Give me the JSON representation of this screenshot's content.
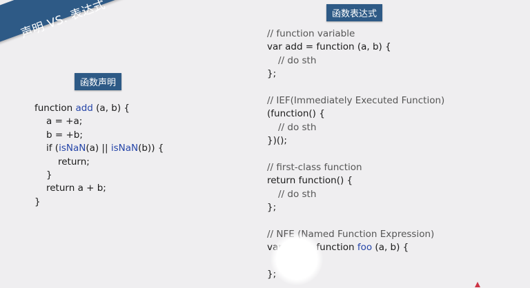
{
  "banner": {
    "title": "声明 VS. 表达式"
  },
  "declaration": {
    "label": "函数声明",
    "code": [
      {
        "segments": [
          {
            "t": "function "
          },
          {
            "t": "add",
            "c": "fn"
          },
          {
            "t": " (a, b) {"
          }
        ]
      },
      {
        "indent": 1,
        "segments": [
          {
            "t": "a = +a;"
          }
        ]
      },
      {
        "indent": 1,
        "segments": [
          {
            "t": "b = +b;"
          }
        ]
      },
      {
        "indent": 1,
        "segments": [
          {
            "t": "if ("
          },
          {
            "t": "isNaN",
            "c": "fn"
          },
          {
            "t": "(a) || "
          },
          {
            "t": "isNaN",
            "c": "fn"
          },
          {
            "t": "(b)) {"
          }
        ]
      },
      {
        "indent": 2,
        "segments": [
          {
            "t": "return;"
          }
        ]
      },
      {
        "indent": 1,
        "segments": [
          {
            "t": "}"
          }
        ]
      },
      {
        "indent": 1,
        "segments": [
          {
            "t": "return a + b;"
          }
        ]
      },
      {
        "segments": [
          {
            "t": "}"
          }
        ]
      }
    ]
  },
  "expression": {
    "label": "函数表达式",
    "code": [
      {
        "segments": [
          {
            "t": "// function variable",
            "c": "cm"
          }
        ]
      },
      {
        "segments": [
          {
            "t": "var add = function (a, b) {"
          }
        ]
      },
      {
        "indent": 1,
        "segments": [
          {
            "t": "// do sth",
            "c": "cm"
          }
        ]
      },
      {
        "segments": [
          {
            "t": "};"
          }
        ]
      },
      {
        "segments": []
      },
      {
        "segments": [
          {
            "t": "// IEF(Immediately Executed Function)",
            "c": "cm"
          }
        ]
      },
      {
        "segments": [
          {
            "t": "(function() {"
          }
        ]
      },
      {
        "indent": 1,
        "segments": [
          {
            "t": "// do sth",
            "c": "cm"
          }
        ]
      },
      {
        "segments": [
          {
            "t": "})();"
          }
        ]
      },
      {
        "segments": []
      },
      {
        "segments": [
          {
            "t": "// first-class function",
            "c": "cm"
          }
        ]
      },
      {
        "segments": [
          {
            "t": "return function() {"
          }
        ]
      },
      {
        "indent": 1,
        "segments": [
          {
            "t": "// do sth",
            "c": "cm"
          }
        ]
      },
      {
        "segments": [
          {
            "t": "};"
          }
        ]
      },
      {
        "segments": []
      },
      {
        "segments": [
          {
            "t": "// NFE (Named Function Expression)",
            "c": "cm"
          }
        ]
      },
      {
        "segments": [
          {
            "t": "var add = function "
          },
          {
            "t": "foo",
            "c": "fn"
          },
          {
            "t": " (a, b) {"
          }
        ]
      },
      {
        "indent": 1,
        "segments": [
          {
            "t": "// do sth",
            "c": "cm"
          }
        ]
      },
      {
        "segments": [
          {
            "t": "};"
          }
        ]
      }
    ]
  }
}
